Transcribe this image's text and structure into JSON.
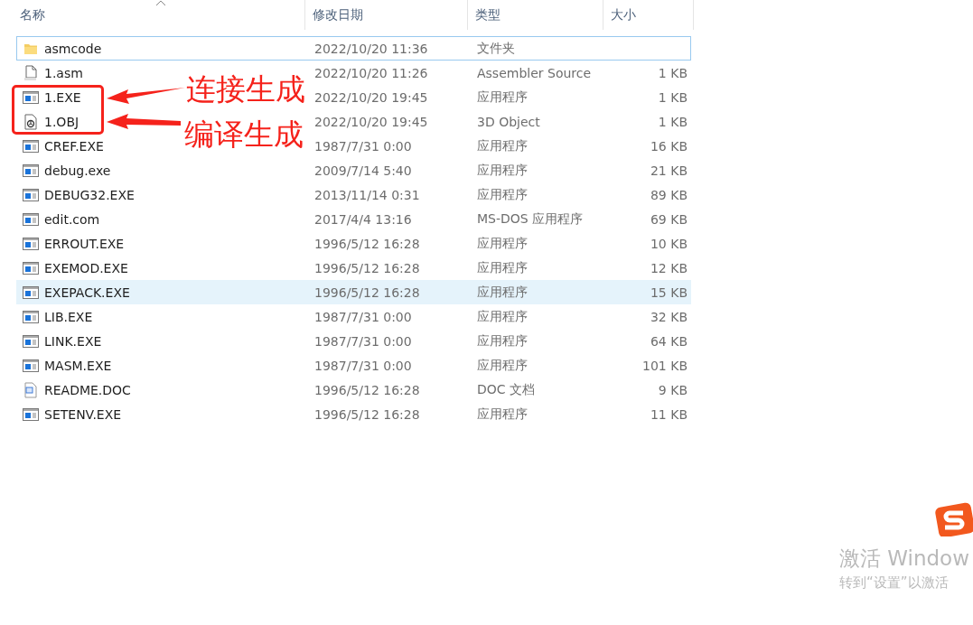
{
  "columns": [
    "名称",
    "修改日期",
    "类型",
    "大小"
  ],
  "rows": [
    {
      "kind": "folder",
      "name": "asmcode",
      "date": "2022/10/20 11:36",
      "type": "文件夹",
      "size": "",
      "focused": true,
      "hovered": false
    },
    {
      "kind": "asm",
      "name": "1.asm",
      "date": "2022/10/20 11:26",
      "type": "Assembler Source",
      "size": "1 KB",
      "focused": false,
      "hovered": false
    },
    {
      "kind": "exe",
      "name": "1.EXE",
      "date": "2022/10/20 19:45",
      "type": "应用程序",
      "size": "1 KB",
      "focused": false,
      "hovered": false
    },
    {
      "kind": "obj",
      "name": "1.OBJ",
      "date": "2022/10/20 19:45",
      "type": "3D Object",
      "size": "1 KB",
      "focused": false,
      "hovered": false
    },
    {
      "kind": "exe",
      "name": "CREF.EXE",
      "date": "1987/7/31 0:00",
      "type": "应用程序",
      "size": "16 KB",
      "focused": false,
      "hovered": false
    },
    {
      "kind": "exe",
      "name": "debug.exe",
      "date": "2009/7/14 5:40",
      "type": "应用程序",
      "size": "21 KB",
      "focused": false,
      "hovered": false
    },
    {
      "kind": "exe",
      "name": "DEBUG32.EXE",
      "date": "2013/11/14 0:31",
      "type": "应用程序",
      "size": "89 KB",
      "focused": false,
      "hovered": false
    },
    {
      "kind": "exe",
      "name": "edit.com",
      "date": "2017/4/4 13:16",
      "type": "MS-DOS 应用程序",
      "size": "69 KB",
      "focused": false,
      "hovered": false
    },
    {
      "kind": "exe",
      "name": "ERROUT.EXE",
      "date": "1996/5/12 16:28",
      "type": "应用程序",
      "size": "10 KB",
      "focused": false,
      "hovered": false
    },
    {
      "kind": "exe",
      "name": "EXEMOD.EXE",
      "date": "1996/5/12 16:28",
      "type": "应用程序",
      "size": "12 KB",
      "focused": false,
      "hovered": false
    },
    {
      "kind": "exe",
      "name": "EXEPACK.EXE",
      "date": "1996/5/12 16:28",
      "type": "应用程序",
      "size": "15 KB",
      "focused": false,
      "hovered": true
    },
    {
      "kind": "exe",
      "name": "LIB.EXE",
      "date": "1987/7/31 0:00",
      "type": "应用程序",
      "size": "32 KB",
      "focused": false,
      "hovered": false
    },
    {
      "kind": "exe",
      "name": "LINK.EXE",
      "date": "1987/7/31 0:00",
      "type": "应用程序",
      "size": "64 KB",
      "focused": false,
      "hovered": false
    },
    {
      "kind": "exe",
      "name": "MASM.EXE",
      "date": "1987/7/31 0:00",
      "type": "应用程序",
      "size": "101 KB",
      "focused": false,
      "hovered": false
    },
    {
      "kind": "doc",
      "name": "README.DOC",
      "date": "1996/5/12 16:28",
      "type": "DOC 文档",
      "size": "9 KB",
      "focused": false,
      "hovered": false
    },
    {
      "kind": "exe",
      "name": "SETENV.EXE",
      "date": "1996/5/12 16:28",
      "type": "应用程序",
      "size": "11 KB",
      "focused": false,
      "hovered": false
    }
  ],
  "annotations": [
    "连接生成",
    "编译生成"
  ],
  "activation": {
    "title": "激活 Window",
    "hint": "转到“设置”以激活"
  }
}
